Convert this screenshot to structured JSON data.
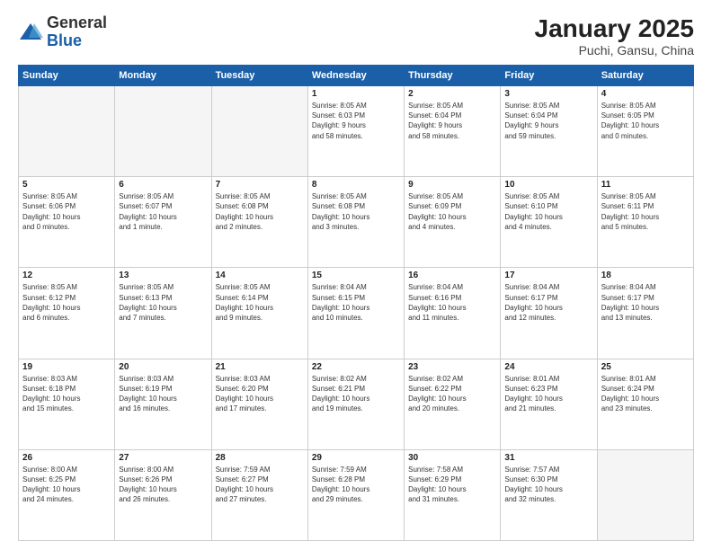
{
  "logo": {
    "general": "General",
    "blue": "Blue"
  },
  "title": "January 2025",
  "subtitle": "Puchi, Gansu, China",
  "days_of_week": [
    "Sunday",
    "Monday",
    "Tuesday",
    "Wednesday",
    "Thursday",
    "Friday",
    "Saturday"
  ],
  "weeks": [
    [
      {
        "day": "",
        "info": ""
      },
      {
        "day": "",
        "info": ""
      },
      {
        "day": "",
        "info": ""
      },
      {
        "day": "1",
        "info": "Sunrise: 8:05 AM\nSunset: 6:03 PM\nDaylight: 9 hours\nand 58 minutes."
      },
      {
        "day": "2",
        "info": "Sunrise: 8:05 AM\nSunset: 6:04 PM\nDaylight: 9 hours\nand 58 minutes."
      },
      {
        "day": "3",
        "info": "Sunrise: 8:05 AM\nSunset: 6:04 PM\nDaylight: 9 hours\nand 59 minutes."
      },
      {
        "day": "4",
        "info": "Sunrise: 8:05 AM\nSunset: 6:05 PM\nDaylight: 10 hours\nand 0 minutes."
      }
    ],
    [
      {
        "day": "5",
        "info": "Sunrise: 8:05 AM\nSunset: 6:06 PM\nDaylight: 10 hours\nand 0 minutes."
      },
      {
        "day": "6",
        "info": "Sunrise: 8:05 AM\nSunset: 6:07 PM\nDaylight: 10 hours\nand 1 minute."
      },
      {
        "day": "7",
        "info": "Sunrise: 8:05 AM\nSunset: 6:08 PM\nDaylight: 10 hours\nand 2 minutes."
      },
      {
        "day": "8",
        "info": "Sunrise: 8:05 AM\nSunset: 6:08 PM\nDaylight: 10 hours\nand 3 minutes."
      },
      {
        "day": "9",
        "info": "Sunrise: 8:05 AM\nSunset: 6:09 PM\nDaylight: 10 hours\nand 4 minutes."
      },
      {
        "day": "10",
        "info": "Sunrise: 8:05 AM\nSunset: 6:10 PM\nDaylight: 10 hours\nand 4 minutes."
      },
      {
        "day": "11",
        "info": "Sunrise: 8:05 AM\nSunset: 6:11 PM\nDaylight: 10 hours\nand 5 minutes."
      }
    ],
    [
      {
        "day": "12",
        "info": "Sunrise: 8:05 AM\nSunset: 6:12 PM\nDaylight: 10 hours\nand 6 minutes."
      },
      {
        "day": "13",
        "info": "Sunrise: 8:05 AM\nSunset: 6:13 PM\nDaylight: 10 hours\nand 7 minutes."
      },
      {
        "day": "14",
        "info": "Sunrise: 8:05 AM\nSunset: 6:14 PM\nDaylight: 10 hours\nand 9 minutes."
      },
      {
        "day": "15",
        "info": "Sunrise: 8:04 AM\nSunset: 6:15 PM\nDaylight: 10 hours\nand 10 minutes."
      },
      {
        "day": "16",
        "info": "Sunrise: 8:04 AM\nSunset: 6:16 PM\nDaylight: 10 hours\nand 11 minutes."
      },
      {
        "day": "17",
        "info": "Sunrise: 8:04 AM\nSunset: 6:17 PM\nDaylight: 10 hours\nand 12 minutes."
      },
      {
        "day": "18",
        "info": "Sunrise: 8:04 AM\nSunset: 6:17 PM\nDaylight: 10 hours\nand 13 minutes."
      }
    ],
    [
      {
        "day": "19",
        "info": "Sunrise: 8:03 AM\nSunset: 6:18 PM\nDaylight: 10 hours\nand 15 minutes."
      },
      {
        "day": "20",
        "info": "Sunrise: 8:03 AM\nSunset: 6:19 PM\nDaylight: 10 hours\nand 16 minutes."
      },
      {
        "day": "21",
        "info": "Sunrise: 8:03 AM\nSunset: 6:20 PM\nDaylight: 10 hours\nand 17 minutes."
      },
      {
        "day": "22",
        "info": "Sunrise: 8:02 AM\nSunset: 6:21 PM\nDaylight: 10 hours\nand 19 minutes."
      },
      {
        "day": "23",
        "info": "Sunrise: 8:02 AM\nSunset: 6:22 PM\nDaylight: 10 hours\nand 20 minutes."
      },
      {
        "day": "24",
        "info": "Sunrise: 8:01 AM\nSunset: 6:23 PM\nDaylight: 10 hours\nand 21 minutes."
      },
      {
        "day": "25",
        "info": "Sunrise: 8:01 AM\nSunset: 6:24 PM\nDaylight: 10 hours\nand 23 minutes."
      }
    ],
    [
      {
        "day": "26",
        "info": "Sunrise: 8:00 AM\nSunset: 6:25 PM\nDaylight: 10 hours\nand 24 minutes."
      },
      {
        "day": "27",
        "info": "Sunrise: 8:00 AM\nSunset: 6:26 PM\nDaylight: 10 hours\nand 26 minutes."
      },
      {
        "day": "28",
        "info": "Sunrise: 7:59 AM\nSunset: 6:27 PM\nDaylight: 10 hours\nand 27 minutes."
      },
      {
        "day": "29",
        "info": "Sunrise: 7:59 AM\nSunset: 6:28 PM\nDaylight: 10 hours\nand 29 minutes."
      },
      {
        "day": "30",
        "info": "Sunrise: 7:58 AM\nSunset: 6:29 PM\nDaylight: 10 hours\nand 31 minutes."
      },
      {
        "day": "31",
        "info": "Sunrise: 7:57 AM\nSunset: 6:30 PM\nDaylight: 10 hours\nand 32 minutes."
      },
      {
        "day": "",
        "info": ""
      }
    ]
  ]
}
